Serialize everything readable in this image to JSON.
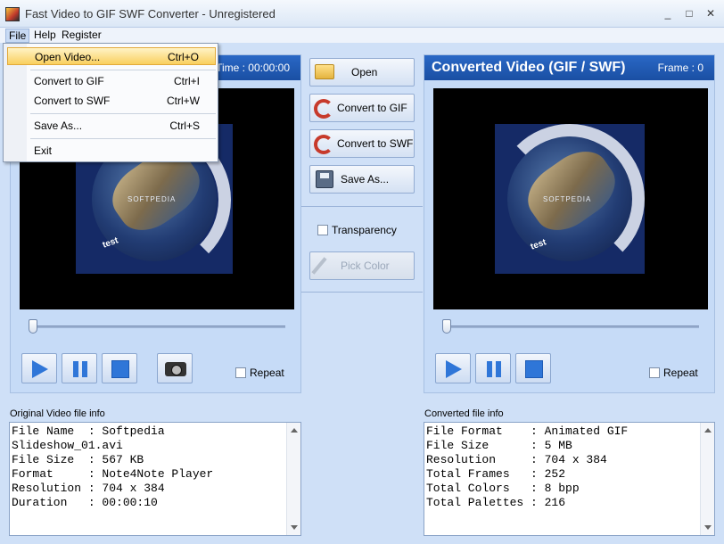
{
  "window": {
    "title": "Fast Video to GIF SWF Converter - Unregistered",
    "minimize": "_",
    "maximize": "□",
    "close": "✕"
  },
  "menubar": {
    "items": [
      {
        "label": "File"
      },
      {
        "label": "Help"
      },
      {
        "label": "Register"
      }
    ]
  },
  "file_menu": {
    "items": [
      {
        "label": "Open Video...",
        "shortcut": "Ctrl+O"
      },
      {
        "label": "Convert to GIF",
        "shortcut": "Ctrl+I"
      },
      {
        "label": "Convert to SWF",
        "shortcut": "Ctrl+W"
      },
      {
        "label": "Save As...",
        "shortcut": "Ctrl+S"
      },
      {
        "label": "Exit",
        "shortcut": ""
      }
    ]
  },
  "original_panel": {
    "time": "Time : 00:00:00",
    "repeat_label": "Repeat"
  },
  "converted_panel": {
    "title": "Converted Video (GIF / SWF)",
    "frame": "Frame : 0",
    "repeat_label": "Repeat"
  },
  "preview": {
    "watermark": "SOFTPEDIA",
    "caption": "test"
  },
  "actions": {
    "open": "Open",
    "convert_gif": "Convert to GIF",
    "convert_swf": "Convert to SWF",
    "save_as": "Save As...",
    "transparency": "Transparency",
    "pick_color": "Pick Color"
  },
  "original_info": {
    "label": "Original Video file info",
    "lines": [
      "File Name  : Softpedia",
      "Slideshow_01.avi",
      "File Size  : 567 KB",
      "Format     : Note4Note Player",
      "Resolution : 704 x 384",
      "Duration   : 00:00:10"
    ]
  },
  "converted_info": {
    "label": "Converted file info",
    "lines": [
      "File Format    : Animated GIF",
      "File Size      : 5 MB",
      "Resolution     : 704 x 384",
      "Total Frames   : 252",
      "Total Colors   : 8 bpp",
      "Total Palettes : 216"
    ]
  }
}
